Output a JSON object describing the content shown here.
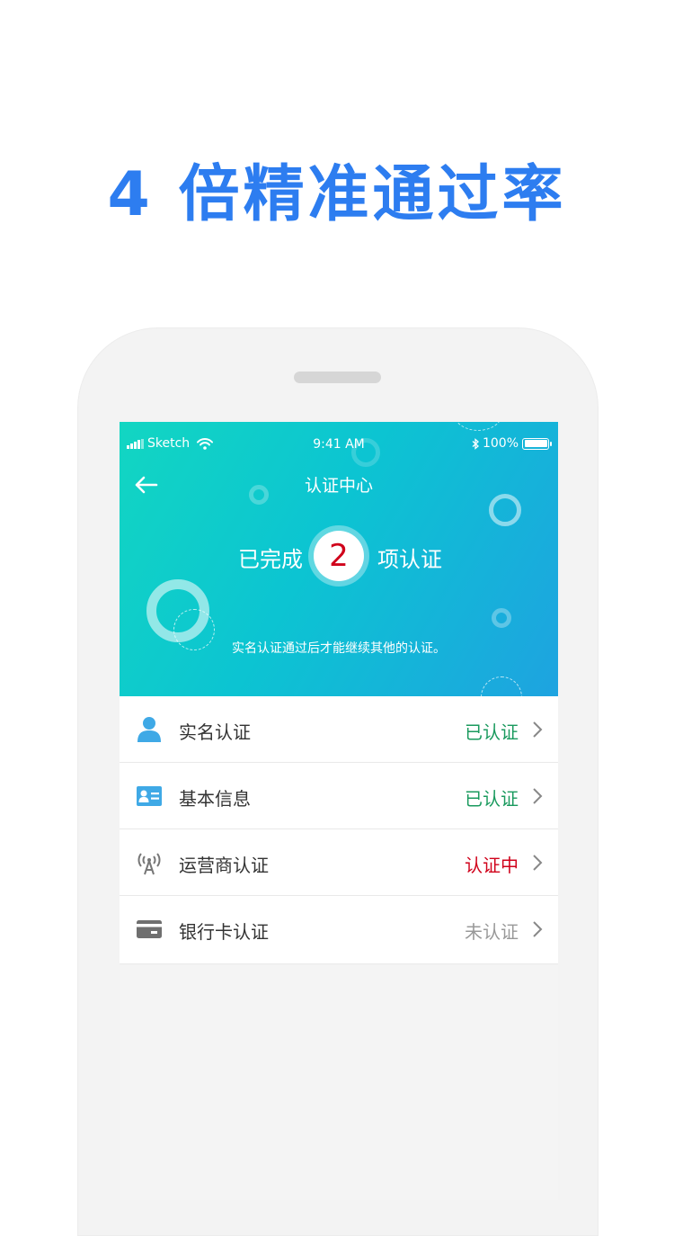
{
  "headline": "4 倍精准通过率",
  "statusbar": {
    "carrier": "Sketch",
    "time": "9:41 AM",
    "battery": "100%"
  },
  "navbar": {
    "title": "认证中心"
  },
  "summary": {
    "prefix": "已完成",
    "count": "2",
    "suffix": "项认证",
    "hint": "实名认证通过后才能继续其他的认证。"
  },
  "colors": {
    "accent": "#2d7df0",
    "verified": "#1a9a5e",
    "pending": "#d0021b",
    "unverified": "#999999"
  },
  "items": [
    {
      "icon": "person-icon",
      "label": "实名认证",
      "status": "已认证",
      "state": "verified"
    },
    {
      "icon": "id-card-icon",
      "label": "基本信息",
      "status": "已认证",
      "state": "verified"
    },
    {
      "icon": "signal-tower-icon",
      "label": "运营商认证",
      "status": "认证中",
      "state": "pending"
    },
    {
      "icon": "bank-card-icon",
      "label": "银行卡认证",
      "status": "未认证",
      "state": "unverified"
    }
  ]
}
